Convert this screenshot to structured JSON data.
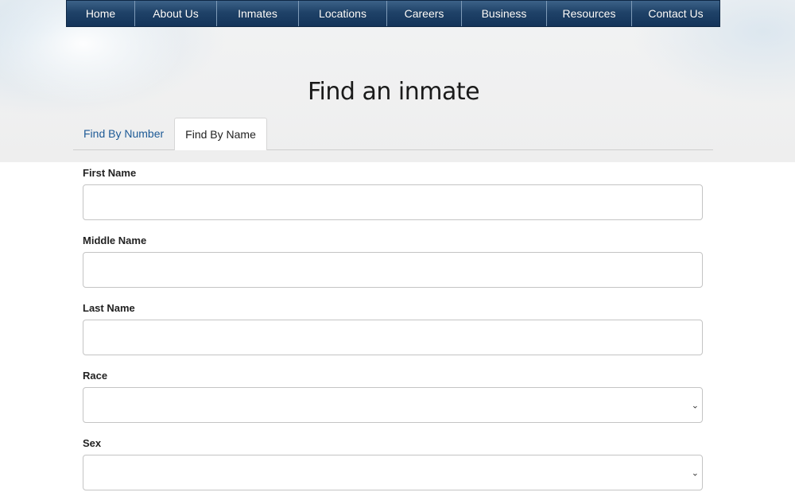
{
  "nav": {
    "items": [
      {
        "label": "Home"
      },
      {
        "label": "About Us"
      },
      {
        "label": "Inmates"
      },
      {
        "label": "Locations"
      },
      {
        "label": "Careers"
      },
      {
        "label": "Business"
      },
      {
        "label": "Resources"
      },
      {
        "label": "Contact Us"
      }
    ]
  },
  "page": {
    "title": "Find an inmate"
  },
  "tabs": [
    {
      "label": "Find By Number",
      "active": false
    },
    {
      "label": "Find By Name",
      "active": true
    }
  ],
  "form": {
    "fields": [
      {
        "label": "First Name",
        "type": "text",
        "value": ""
      },
      {
        "label": "Middle Name",
        "type": "text",
        "value": ""
      },
      {
        "label": "Last Name",
        "type": "text",
        "value": ""
      },
      {
        "label": "Race",
        "type": "select",
        "selected": "",
        "icon": "chevron-down-icon"
      },
      {
        "label": "Sex",
        "type": "select",
        "selected": "",
        "icon": "chevron-down-icon"
      }
    ]
  },
  "colors": {
    "nav_bg": "#1f4268",
    "tab_link": "#1d5a96"
  }
}
